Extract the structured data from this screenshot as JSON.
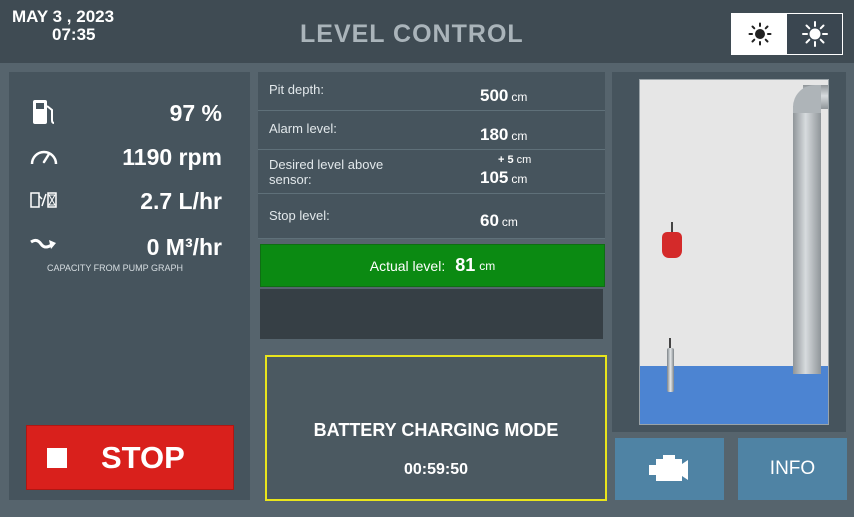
{
  "header": {
    "date": "MAY  3 , 2023",
    "time": "07:35",
    "title": "LEVEL CONTROL",
    "brightness_low_icon": "sun-low-icon",
    "brightness_high_icon": "sun-high-icon"
  },
  "status": {
    "fuel_icon": "fuel-pump-icon",
    "fuel": "97 %",
    "speed_icon": "speedometer-icon",
    "speed": "1190 rpm",
    "consumption_icon": "fuel-rate-icon",
    "consumption": "2.7 L/hr",
    "flow_icon": "flow-arrow-icon",
    "flow": "0 M³/hr",
    "capacity_note": "CAPACITY FROM PUMP GRAPH",
    "stop_label": "STOP"
  },
  "params": {
    "pit_depth": {
      "label": "Pit depth:",
      "value": "500",
      "unit": "cm"
    },
    "alarm_level": {
      "label": "Alarm level:",
      "value": "180",
      "unit": "cm"
    },
    "desired_level": {
      "label_line1": "Desired level above",
      "label_line2": "sensor:",
      "offset_sign": "+ 5",
      "offset_unit": "cm",
      "value": "105",
      "unit": "cm"
    },
    "stop_level": {
      "label": "Stop level:",
      "value": "60",
      "unit": "cm"
    },
    "actual_level": {
      "label": "Actual level:",
      "value": "81",
      "unit": "cm"
    }
  },
  "battery": {
    "mode": "BATTERY CHARGING MODE",
    "timer": "00:59:50"
  },
  "buttons": {
    "engine_icon": "engine-icon",
    "info_label": "INFO"
  },
  "colors": {
    "stop": "#d9201c",
    "actual_ok": "#0b8a12",
    "battery_border": "#e9e51c",
    "button": "#4f83a4",
    "water": "#4c84d2"
  }
}
